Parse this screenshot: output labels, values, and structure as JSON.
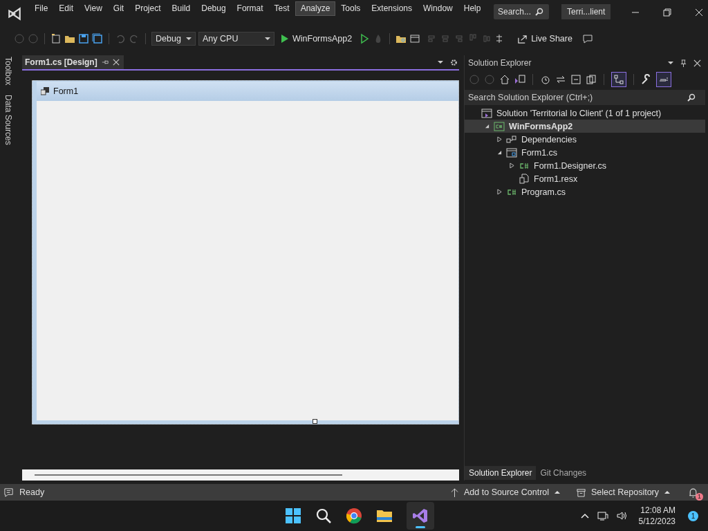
{
  "menu": [
    {
      "label": "File",
      "highlighted": false
    },
    {
      "label": "Edit",
      "highlighted": false
    },
    {
      "label": "View",
      "highlighted": false
    },
    {
      "label": "Git",
      "highlighted": false
    },
    {
      "label": "Project",
      "highlighted": false
    },
    {
      "label": "Build",
      "highlighted": false
    },
    {
      "label": "Debug",
      "highlighted": false
    },
    {
      "label": "Format",
      "highlighted": false
    },
    {
      "label": "Test",
      "highlighted": false
    },
    {
      "label": "Analyze",
      "highlighted": true
    },
    {
      "label": "Tools",
      "highlighted": false
    },
    {
      "label": "Extensions",
      "highlighted": false
    },
    {
      "label": "Window",
      "highlighted": false
    },
    {
      "label": "Help",
      "highlighted": false
    }
  ],
  "search": {
    "placeholder": "Search..."
  },
  "solution_badge": "Terri...lient",
  "toolbar": {
    "configuration": "Debug",
    "platform": "Any CPU",
    "start_target": "WinFormsApp2",
    "live_share": "Live Share"
  },
  "side_tabs": [
    "Toolbox",
    "Data Sources"
  ],
  "document_tab": {
    "title": "Form1.cs [Design]"
  },
  "form": {
    "title": "Form1"
  },
  "solution_explorer": {
    "title": "Solution Explorer",
    "search": {
      "placeholder": "Search Solution Explorer (Ctrl+;)"
    },
    "tree": [
      {
        "label": "Solution 'Territorial Io Client' (1 of 1 project)",
        "kind": "solution",
        "selected": false,
        "children": [
          {
            "label": "WinFormsApp2",
            "kind": "project",
            "selected": true,
            "expanded": true,
            "children": [
              {
                "label": "Dependencies",
                "kind": "dependencies",
                "selected": false,
                "expanded": false
              },
              {
                "label": "Form1.cs",
                "kind": "form",
                "selected": false,
                "expanded": true,
                "children": [
                  {
                    "label": "Form1.Designer.cs",
                    "kind": "csharp",
                    "selected": false,
                    "expanded": false
                  },
                  {
                    "label": "Form1.resx",
                    "kind": "resx",
                    "selected": false
                  }
                ]
              },
              {
                "label": "Program.cs",
                "kind": "csharp",
                "selected": false,
                "expanded": false
              }
            ]
          }
        ]
      }
    ],
    "bottom_tabs": [
      {
        "label": "Solution Explorer",
        "selected": true
      },
      {
        "label": "Git Changes",
        "selected": false
      }
    ]
  },
  "status_bar": {
    "status": "Ready",
    "source_control": "Add to Source Control",
    "repository": "Select Repository",
    "notifications": "1"
  },
  "taskbar": {
    "time": "12:08 AM",
    "date": "5/12/2023",
    "notification_count": "1"
  }
}
